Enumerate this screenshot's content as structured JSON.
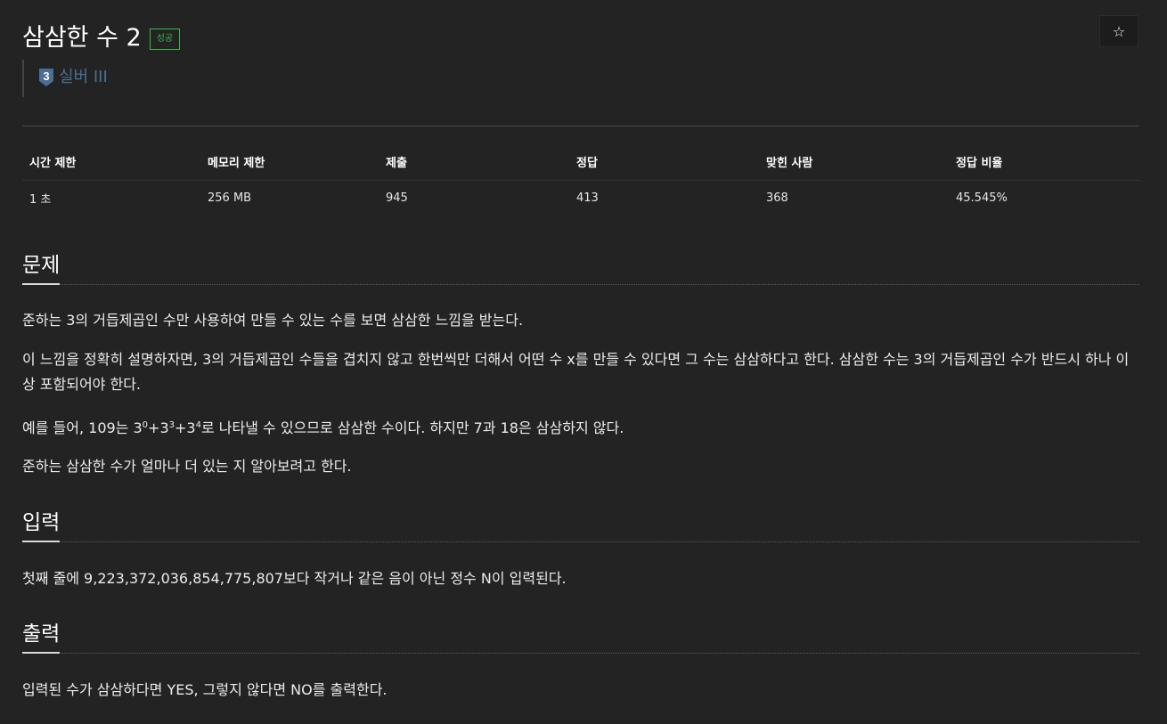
{
  "problem": {
    "title": "삼삼한 수 2",
    "status_badge": "성공",
    "star_icon": "☆"
  },
  "tier": {
    "number": "3",
    "label": "실버 III",
    "color": "#4a6f92"
  },
  "info_table": {
    "headers": [
      "시간 제한",
      "메모리 제한",
      "제출",
      "정답",
      "맞힌 사람",
      "정답 비율"
    ],
    "values": [
      "1 초",
      "256 MB",
      "945",
      "413",
      "368",
      "45.545%"
    ]
  },
  "sections": {
    "description": {
      "heading": "문제",
      "p1": "준하는 3의 거듭제곱인 수만 사용하여 만들 수 있는 수를 보면 삼삼한 느낌을 받는다.",
      "p2": "이 느낌을 정확히 설명하자면, 3의 거듭제곱인 수들을 겹치지 않고 한번씩만 더해서 어떤 수 x를 만들 수 있다면 그 수는 삼삼하다고 한다. 삼삼한 수는 3의 거듭제곱인 수가 반드시 하나 이상 포함되어야 한다.",
      "p3_prefix": "예를 들어, 109는 3",
      "p3_exp1": "0",
      "p3_mid1": "+3",
      "p3_exp2": "3",
      "p3_mid2": "+3",
      "p3_exp3": "4",
      "p3_suffix": "로 나타낼 수 있으므로 삼삼한 수이다. 하지만 7과 18은 삼삼하지 않다.",
      "p4": "준하는 삼삼한 수가 얼마나 더 있는 지 알아보려고 한다."
    },
    "input": {
      "heading": "입력",
      "p1": "첫째 줄에 9,223,372,036,854,775,807보다 작거나 같은 음이 아닌 정수 N이 입력된다."
    },
    "output": {
      "heading": "출력",
      "p1": "입력된 수가 삼삼하다면 YES, 그렇지 않다면 NO를 출력한다."
    }
  }
}
